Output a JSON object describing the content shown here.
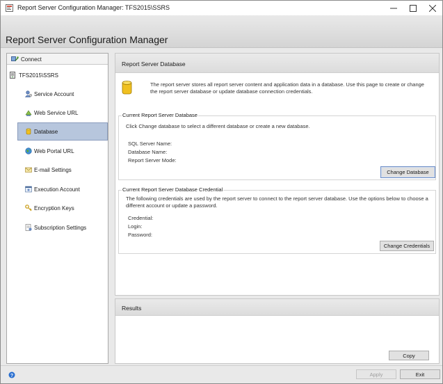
{
  "window": {
    "title": "Report Server Configuration Manager: TFS2015\\SSRS",
    "minimize_icon": "minimize-icon",
    "maximize_icon": "maximize-icon",
    "close_icon": "close-icon"
  },
  "header": {
    "title": "Report Server Configuration Manager"
  },
  "sidebar": {
    "connect_label": "Connect",
    "server_label": "TFS2015\\SSRS",
    "items": [
      {
        "label": "Service Account",
        "icon": "service-account-icon"
      },
      {
        "label": "Web Service URL",
        "icon": "web-service-url-icon"
      },
      {
        "label": "Database",
        "icon": "database-icon",
        "selected": true
      },
      {
        "label": "Web Portal URL",
        "icon": "globe-icon"
      },
      {
        "label": "E-mail Settings",
        "icon": "email-icon"
      },
      {
        "label": "Execution Account",
        "icon": "execution-account-icon"
      },
      {
        "label": "Encryption Keys",
        "icon": "key-icon"
      },
      {
        "label": "Subscription Settings",
        "icon": "subscription-icon"
      }
    ]
  },
  "main": {
    "section_title": "Report Server Database",
    "intro_text": "The report server stores all report server content and application data in a database. Use this page to create or change the report server database or update database connection credentials.",
    "current_db": {
      "caption": "Current Report Server Database",
      "instruction": "Click Change database to select a different database or create a new database.",
      "fields": [
        "SQL Server Name:",
        "Database Name:",
        "Report Server Mode:"
      ],
      "change_button": "Change Database"
    },
    "credential": {
      "caption": "Current Report Server Database Credential",
      "description": "The following credentials are used by the report server to connect to the report server database. Use the options below to choose a different account or update a password.",
      "fields": [
        "Credential:",
        "Login:",
        "Password:"
      ],
      "change_button": "Change Credentials"
    }
  },
  "results": {
    "title": "Results",
    "copy_button": "Copy"
  },
  "footer": {
    "apply_button": "Apply",
    "exit_button": "Exit"
  },
  "colors": {
    "selected_bg": "#b7c6dd",
    "accent_border": "#6f8fc6",
    "db_icon": "#f0c020"
  }
}
